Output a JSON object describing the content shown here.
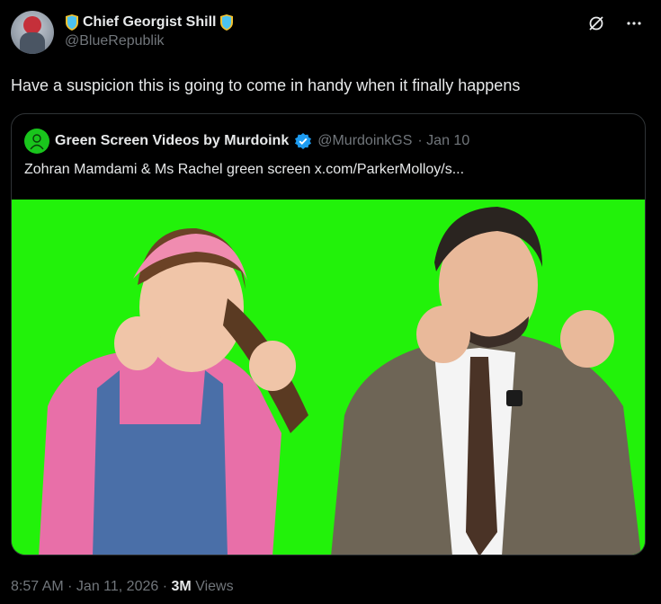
{
  "author": {
    "display_name": "Chief Georgist Shill",
    "handle": "@BlueRepublik",
    "badge_icon": "shield-badge-icon",
    "badge_color": "#4cc3f0"
  },
  "tweet": {
    "text": "Have a suspicion this is going to come in handy when it finally happens",
    "timestamp": "8:57 AM · Jan 11, 2026",
    "sep": "·",
    "views_count": "3M",
    "views_label": "Views"
  },
  "quoted": {
    "display_name": "Green Screen Videos by Murdoink",
    "handle": "@MurdoinkGS",
    "date": "· Jan 10",
    "text": "Zohran Mamdami & Ms Rachel green screen  x.com/ParkerMolloy/s...",
    "media_bg": "#22f20a"
  },
  "icons": {
    "grok": "grok-icon",
    "more": "more-icon",
    "verified": "verified-badge-icon"
  }
}
